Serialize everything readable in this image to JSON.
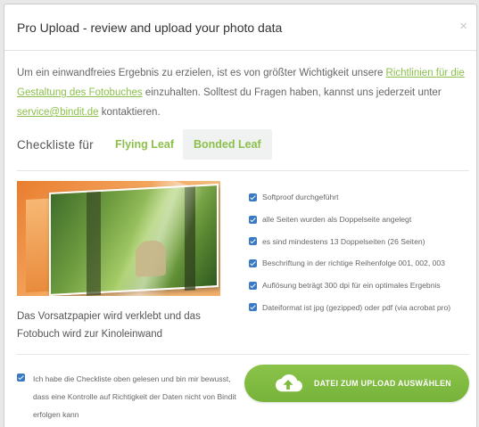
{
  "modal": {
    "title": "Pro Upload - review and upload your photo data",
    "close_glyph": "×"
  },
  "intro": {
    "text_1": "Um ein einwandfreies Ergebnis zu erzielen, ist es von größter Wichtigkeit unsere ",
    "link_guidelines": "Richtlinien für die Gestaltung des Fotobuches",
    "text_2": " einzuhalten. Solltest du Fragen haben, kannst uns jederzeit unter ",
    "link_email": "service@bindit.de",
    "text_3": " kontaktieren."
  },
  "tabs": {
    "label": "Checkliste für",
    "items": [
      {
        "label": "Flying Leaf"
      },
      {
        "label": "Bonded Leaf"
      }
    ],
    "active": "Bonded Leaf"
  },
  "preview": {
    "caption": "Das Vorsatzpapier wird verklebt und das Fotobuch wird zur Kinoleinwand"
  },
  "checklist": [
    "Softproof durchgeführt",
    "alle Seiten wurden als Doppelseite angelegt",
    "es sind mindestens 13 Doppelseiten (26 Seiten)",
    "Beschriftung in der richtige Reihenfolge 001, 002, 003",
    "Auflösung beträgt 300 dpi für ein optimales Ergebnis",
    "Dateiformat ist jpg (gezipped) oder pdf (via acrobat pro)"
  ],
  "confirm": {
    "text": "Ich habe die Checkliste oben gelesen und bin mir bewusst, dass eine Kontrolle auf Richtigkeit der Daten nicht von Bindit erfolgen kann",
    "checked": true
  },
  "upload": {
    "label": "DATEI ZUM UPLOAD AUSWÄHLEN",
    "icon": "cloud-upload-icon"
  },
  "colors": {
    "accent_green": "#8cc04b",
    "checkbox_blue": "#3a79c4",
    "button_green": "#7fbb40"
  }
}
